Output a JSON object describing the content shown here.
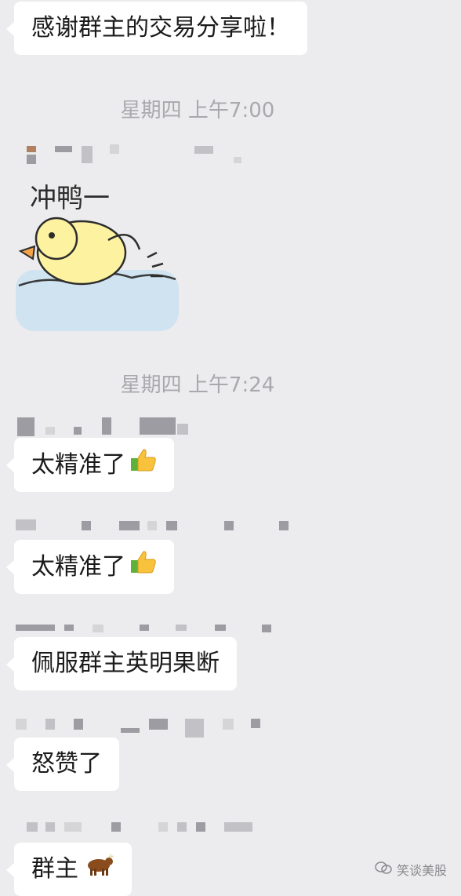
{
  "messages": [
    {
      "text": "感谢群主的交易分享啦！"
    },
    {
      "text": "太精准了"
    },
    {
      "text": "太精准了"
    },
    {
      "text": "佩服群主英明果断"
    },
    {
      "text": "怒赞了"
    },
    {
      "text": "群主"
    }
  ],
  "timestamps": [
    "星期四 上午7:00",
    "星期四 上午7:24"
  ],
  "sticker": {
    "caption": "冲鸭一",
    "icon": "duck-sticker-icon"
  },
  "emojis": {
    "thumbs": "thumbs-up-icon",
    "bull": "bull-icon"
  },
  "watermark": {
    "text": "笑谈美股",
    "icon": "wechat-channel-icon"
  },
  "colors": {
    "background": "#ececee",
    "bubble": "#ffffff",
    "timestamp": "#a9a9ad"
  }
}
